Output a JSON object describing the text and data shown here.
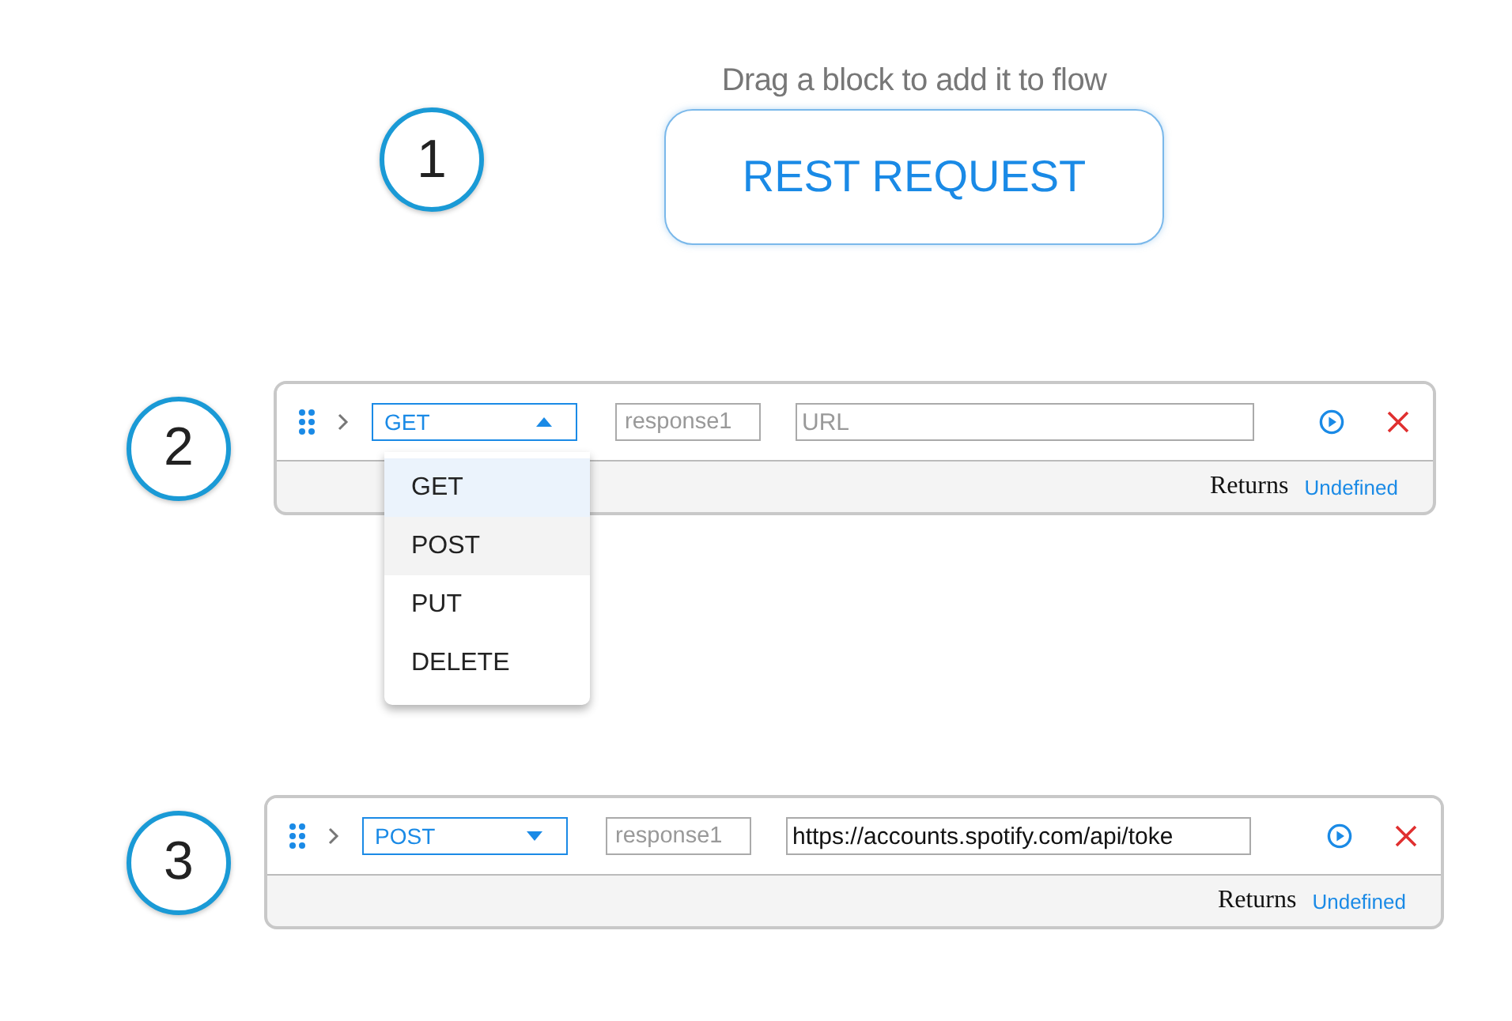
{
  "intro": {
    "number": "1",
    "hint": "Drag a block to add it to flow",
    "block_button": "REST REQUEST"
  },
  "blocks": [
    {
      "number": "2",
      "method": "GET",
      "open": true,
      "variable": {
        "placeholder": "response1"
      },
      "url": {
        "placeholder": "URL"
      },
      "returns_label": "Returns",
      "returns_value": "Undefined",
      "menu": [
        {
          "label": "GET",
          "selected": true,
          "hovered": false
        },
        {
          "label": "POST",
          "selected": false,
          "hovered": true
        },
        {
          "label": "PUT",
          "selected": false,
          "hovered": false
        },
        {
          "label": "DELETE",
          "selected": false,
          "hovered": false
        }
      ]
    },
    {
      "number": "3",
      "method": "POST",
      "open": false,
      "variable": {
        "placeholder": "response1"
      },
      "url": {
        "value": "https://accounts.spotify.com/api/toke"
      },
      "returns_label": "Returns",
      "returns_value": "Undefined"
    }
  ]
}
